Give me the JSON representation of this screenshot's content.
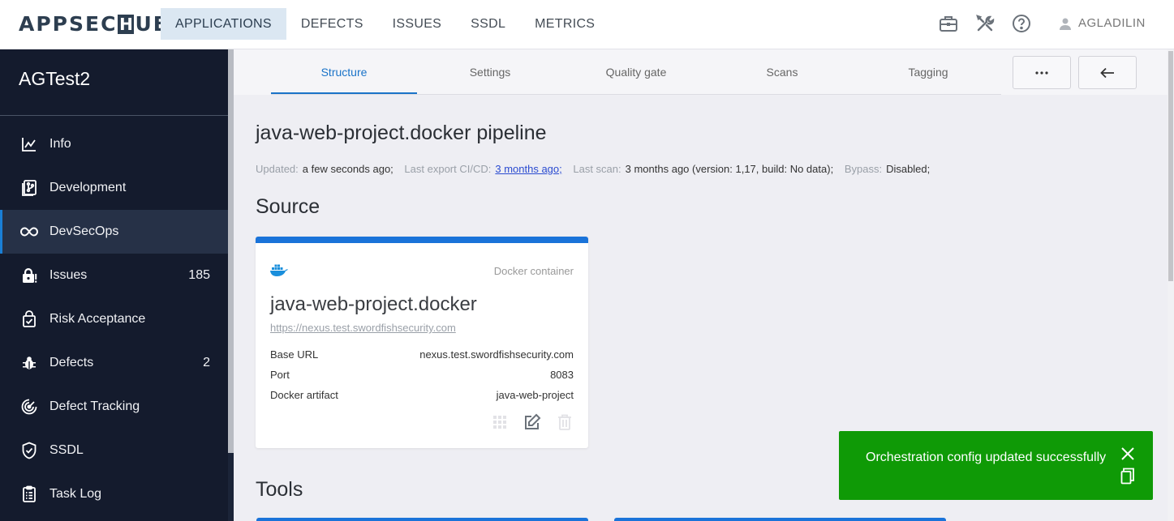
{
  "header": {
    "logo": {
      "part1": "APPSEC",
      "part2": "H",
      "part3": "UB"
    },
    "nav": [
      "APPLICATIONS",
      "DEFECTS",
      "ISSUES",
      "SSDL",
      "METRICS"
    ],
    "active_nav": "APPLICATIONS",
    "icons": [
      "briefcase-icon",
      "tools-icon",
      "help-icon"
    ],
    "user": "AGLADILIN"
  },
  "sidebar": {
    "app_name": "AGTest2",
    "items": [
      {
        "label": "Info",
        "icon": "chart-line-icon",
        "count": ""
      },
      {
        "label": "Development",
        "icon": "source-code-icon",
        "count": ""
      },
      {
        "label": "DevSecOps",
        "icon": "infinity-icon",
        "count": "",
        "active": true
      },
      {
        "label": "Issues",
        "icon": "lock-alert-icon",
        "count": "185"
      },
      {
        "label": "Risk Acceptance",
        "icon": "bag-check-icon",
        "count": ""
      },
      {
        "label": "Defects",
        "icon": "bug-icon",
        "count": "2"
      },
      {
        "label": "Defect Tracking",
        "icon": "radar-icon",
        "count": ""
      },
      {
        "label": "SSDL",
        "icon": "shield-check-icon",
        "count": ""
      },
      {
        "label": "Task Log",
        "icon": "clipboard-list-icon",
        "count": ""
      }
    ]
  },
  "tabs": [
    "Structure",
    "Settings",
    "Quality gate",
    "Scans",
    "Tagging"
  ],
  "active_tab": "Structure",
  "tab_buttons": {
    "more": "more-icon",
    "back": "arrow-left-icon"
  },
  "page": {
    "title": "java-web-project.docker pipeline",
    "meta": {
      "updated_label": "Updated:",
      "updated_value": "a few seconds ago;",
      "export_label": "Last export CI/CD:",
      "export_value": "3 months ago;",
      "scan_label": "Last scan:",
      "scan_value": "3 months ago (version: 1,17, build: No data);",
      "bypass_label": "Bypass:",
      "bypass_value": "Disabled;"
    },
    "source_heading": "Source",
    "tools_heading": "Tools"
  },
  "source_card": {
    "type": "Docker container",
    "name": "java-web-project.docker",
    "url": "https://nexus.test.swordfishsecurity.com",
    "rows": [
      {
        "label": "Base URL",
        "value": "nexus.test.swordfishsecurity.com"
      },
      {
        "label": "Port",
        "value": "8083"
      },
      {
        "label": "Docker artifact",
        "value": "java-web-project"
      }
    ]
  },
  "toast": {
    "message": "Orchestration config updated successfully"
  },
  "colors": {
    "sidebar_bg": "#141b2d",
    "accent": "#1a73d9",
    "toast_bg": "#0f9a06",
    "active_nav_bg": "#dbe7f2"
  }
}
